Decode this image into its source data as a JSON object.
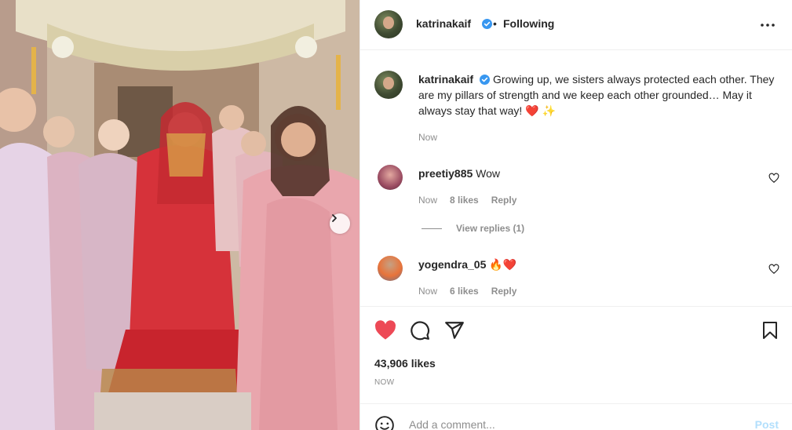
{
  "header": {
    "username": "katrinakaif",
    "separator": "•",
    "follow_state": "Following",
    "more_icon": "more-horizontal-icon"
  },
  "caption": {
    "username": "katrinakaif",
    "text": "Growing up, we sisters always protected each other. They are my pillars of strength and we keep each other grounded… May it always stay that way! ❤️ ✨",
    "time": "Now"
  },
  "comments": [
    {
      "username": "preetiy885",
      "text": "Wow",
      "time": "Now",
      "likes": "8 likes",
      "reply": "Reply"
    },
    {
      "username": "yogendra_05",
      "text": "🔥❤️",
      "time": "Now",
      "likes": "6 likes",
      "reply": "Reply"
    }
  ],
  "view_replies": "View replies (1)",
  "likes": "43,906 likes",
  "post_time": "NOW",
  "add_comment": {
    "placeholder": "Add a comment...",
    "post_label": "Post"
  },
  "colors": {
    "like_red": "#ed4956",
    "verified_blue": "#3897f0",
    "post_disabled": "#b2dffc"
  }
}
